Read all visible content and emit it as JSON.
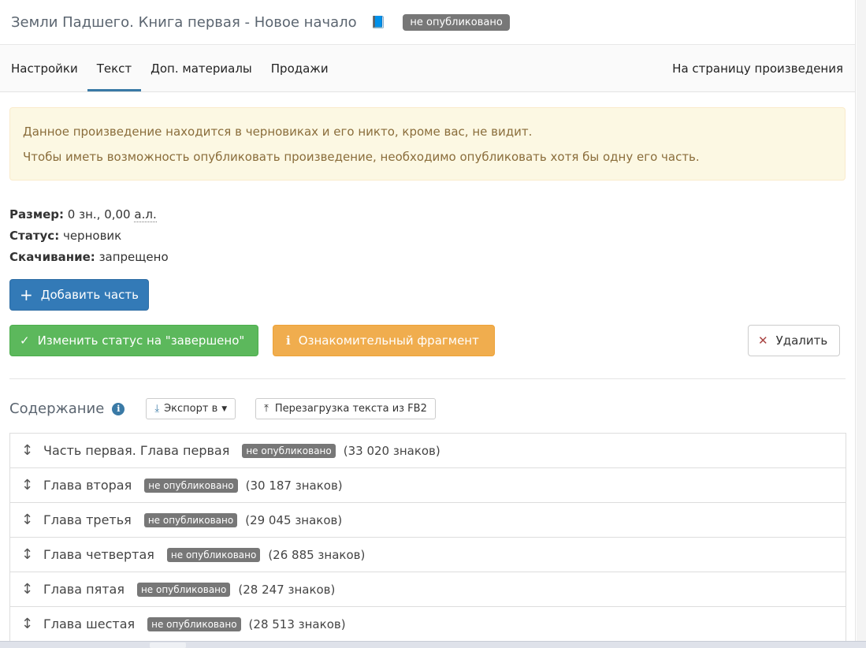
{
  "header": {
    "title": "Земли Падшего. Книга первая - Новое начало",
    "badge": "не опубликовано"
  },
  "tabs": [
    {
      "label": "Настройки"
    },
    {
      "label": "Текст",
      "active": true
    },
    {
      "label": "Доп. материалы"
    },
    {
      "label": "Продажи"
    }
  ],
  "tab_right": "На страницу произведения",
  "alert": {
    "line1": "Данное произведение находится в черновиках и его никто, кроме вас, не видит.",
    "line2": "Чтобы иметь возможность опубликовать произведение, необходимо опубликовать хотя бы одну его часть."
  },
  "meta": {
    "size_label": "Размер:",
    "size_value": "0 зн., 0,00",
    "size_unit": "а.л.",
    "status_label": "Статус:",
    "status_value": "черновик",
    "download_label": "Скачивание:",
    "download_value": "запрещено"
  },
  "buttons": {
    "add_part": "Добавить часть",
    "change_status": "Изменить статус на \"завершено\"",
    "fragment": "Ознакомительный фрагмент",
    "delete": "Удалить"
  },
  "contents": {
    "title": "Содержание",
    "export": "Экспорт в",
    "reload": "Перезагрузка текста из FB2"
  },
  "chapters": [
    {
      "title": "Часть первая. Глава первая",
      "badge": "не опубликовано",
      "count": "(33 020 знаков)"
    },
    {
      "title": "Глава вторая",
      "badge": "не опубликовано",
      "count": "(30 187 знаков)"
    },
    {
      "title": "Глава третья",
      "badge": "не опубликовано",
      "count": "(29 045 знаков)"
    },
    {
      "title": "Глава четвертая",
      "badge": "не опубликовано",
      "count": "(26 885 знаков)"
    },
    {
      "title": "Глава пятая",
      "badge": "не опубликовано",
      "count": "(28 247 знаков)"
    },
    {
      "title": "Глава шестая",
      "badge": "не опубликовано",
      "count": "(28 513 знаков)"
    }
  ]
}
